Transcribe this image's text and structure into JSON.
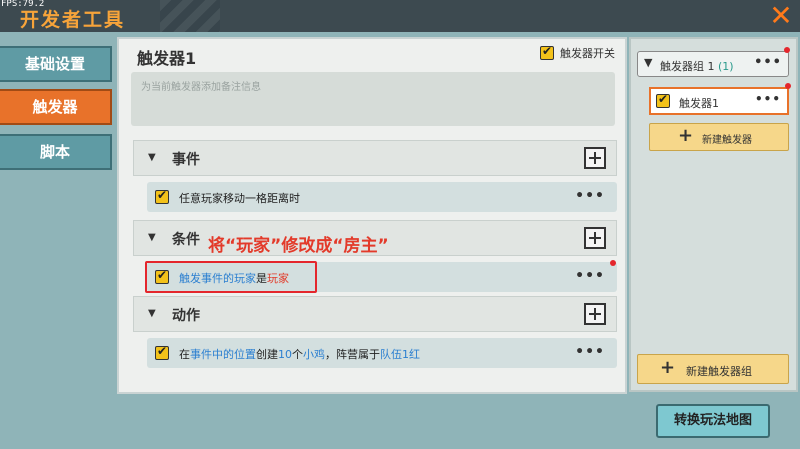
{
  "window": {
    "fps": "FPS:79.2",
    "title": "开发者工具",
    "close_icon": "close-x-icon"
  },
  "tabs": [
    {
      "label": "基础设置",
      "active": false
    },
    {
      "label": "触发器",
      "active": true
    },
    {
      "label": "脚本",
      "active": false
    }
  ],
  "trigger": {
    "name": "触发器1",
    "switch_label": "触发器开关",
    "note_placeholder": "为当前触发器添加备注信息"
  },
  "sections": {
    "event": {
      "label": "事件",
      "row": "任意玩家移动一格距离时"
    },
    "condition": {
      "label": "条件",
      "row": {
        "part1": "触发事件的玩家",
        "part2": "是",
        "part3": "玩家"
      }
    },
    "action": {
      "label": "动作",
      "row": {
        "p1": "在",
        "p2": "事件中的位置",
        "p3": "创建",
        "p4": "10",
        "p5": "个",
        "p6": "小鸡",
        "p7": "，阵营属于",
        "p8": "队伍1红"
      }
    }
  },
  "annotation": "将“玩家”修改成“房主”",
  "right_panel": {
    "group_label": "触发器组 1",
    "group_count": "(1)",
    "trigger_item": "触发器1",
    "new_trigger": "新建触发器",
    "new_group": "新建触发器组"
  },
  "switch_map_button": "转换玩法地图",
  "colors": {
    "accent": "#e8722a",
    "annotation": "#e33a2a",
    "blue_param": "#2b7fd0"
  }
}
